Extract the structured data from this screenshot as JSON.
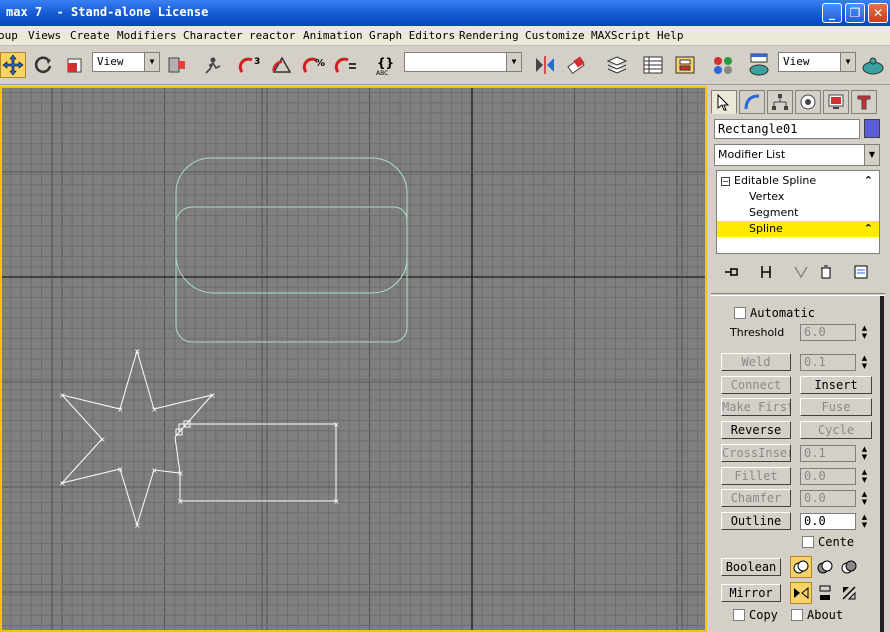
{
  "app": {
    "title": "max 7  - Stand-alone License"
  },
  "menu": [
    "oup",
    "Views",
    "Create",
    "Modifiers",
    "Character",
    "reactor",
    "Animation",
    "Graph Editors",
    "Rendering",
    "Customize",
    "MAXScript",
    "Help"
  ],
  "toolbar": {
    "ref_coord": "View",
    "named_selection": "",
    "render_view": "View"
  },
  "panel": {
    "object_name": "Rectangle01",
    "object_color": "#5b5ed8",
    "modifier_list": "Modifier List",
    "stack": [
      {
        "label": "Editable Spline",
        "selected": false
      },
      {
        "label": "Vertex",
        "selected": false
      },
      {
        "label": "Segment",
        "selected": false
      },
      {
        "label": "Spline",
        "selected": true
      }
    ],
    "automatic_label": "Automatic",
    "threshold_label": "Threshold",
    "threshold_value": "6.0",
    "buttons": {
      "weld": "Weld",
      "weld_value": "0.1",
      "connect": "Connect",
      "insert": "Insert",
      "make_first": "Make First",
      "fuse": "Fuse",
      "reverse": "Reverse",
      "cycle": "Cycle",
      "cross_insert": "CrossInsert",
      "cross_value": "0.1",
      "fillet": "Fillet",
      "fillet_value": "0.0",
      "chamfer": "Chamfer",
      "chamfer_value": "0.0",
      "outline": "Outline",
      "outline_value": "0.0",
      "center_label": "Cente",
      "boolean": "Boolean",
      "mirror": "Mirror",
      "copy_label": "Copy",
      "about_label": "About"
    }
  },
  "colors": {
    "viewport_bg": "#7f7f7f",
    "grid_minor": "#6e6e6e",
    "grid_major": "#1a1a1a",
    "active_border": "#f5c400",
    "selected_spline": "#ffffff",
    "unselected_spline": "#a8e0c0",
    "highlight": "#ffea00"
  }
}
